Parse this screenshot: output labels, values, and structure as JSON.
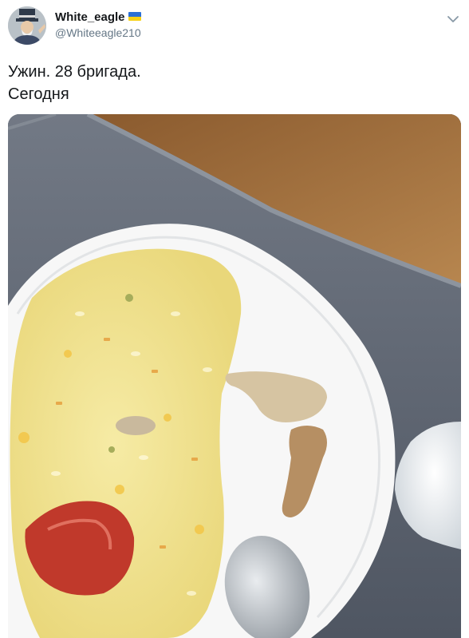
{
  "author": {
    "display_name": "White_eagle",
    "handle": "@Whiteeagle210",
    "flag_icon": "ukraine-flag-icon"
  },
  "tweet": {
    "lines": [
      "Ужин. 28 бригада.",
      "Сегодня"
    ]
  },
  "media": {
    "kind": "photo",
    "icon": "photo-dinner-plate"
  },
  "colors": {
    "text": "#14171a",
    "secondary": "#657786"
  }
}
